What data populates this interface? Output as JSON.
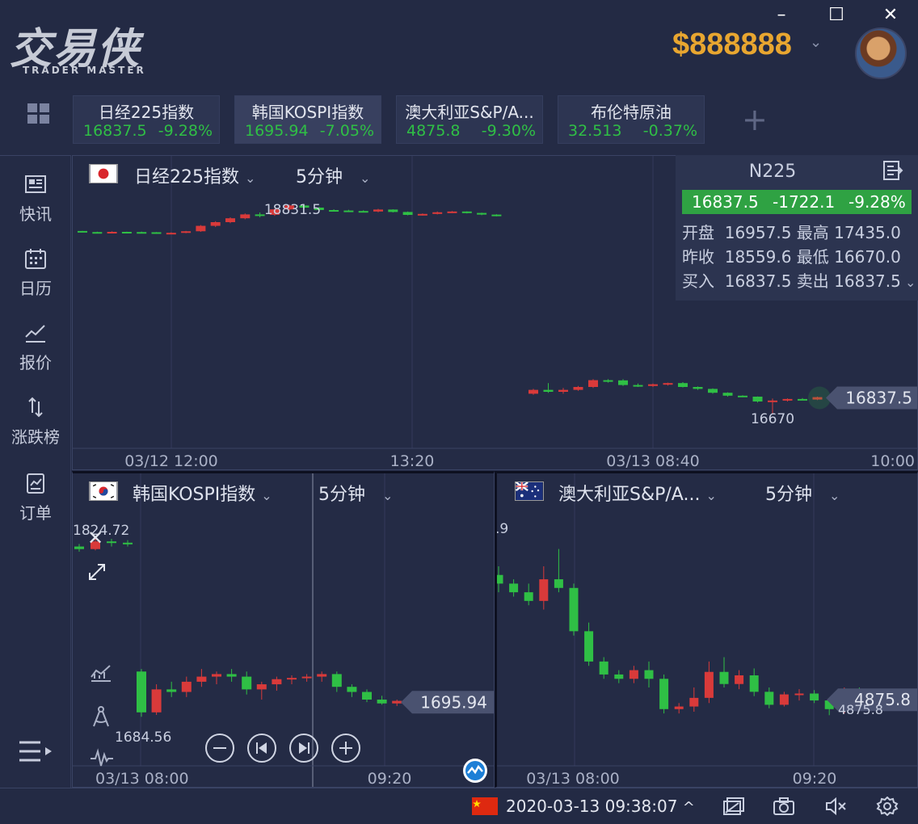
{
  "app": {
    "logo_text": "交易侠",
    "logo_sub": "TRADER MASTER",
    "balance": "$888888",
    "window": {
      "minimize": "–",
      "maximize": "☐",
      "close": "✕"
    }
  },
  "watchlist": [
    {
      "name": "日经225指数",
      "price": "16837.5",
      "change": "-9.28%"
    },
    {
      "name": "韩国KOSPI指数",
      "price": "1695.94",
      "change": "-7.05%"
    },
    {
      "name": "澳大利亚S&P/A...",
      "price": "4875.8",
      "change": "-9.30%"
    },
    {
      "name": "布伦特原油",
      "price": "32.513",
      "change": "-0.37%"
    }
  ],
  "add_tab_label": "+",
  "sidebar": [
    {
      "label": "快讯"
    },
    {
      "label": "日历"
    },
    {
      "label": "报价"
    },
    {
      "label": "涨跌榜"
    },
    {
      "label": "订单"
    }
  ],
  "main_chart": {
    "title": "日经225指数",
    "timeframe": "5分钟",
    "high_label": "18831.5",
    "low_label": "16670",
    "last_price_tag": "16837.5",
    "x_ticks": [
      "03/12 12:00",
      "13:20",
      "03/13 08:40",
      "10:00"
    ]
  },
  "info": {
    "symbol": "N225",
    "price": "16837.5",
    "change": "-1722.1",
    "change_pct": "-9.28%",
    "rows": [
      {
        "k1": "开盘",
        "v1": "16957.5",
        "k2": "最高",
        "v2": "17435.0"
      },
      {
        "k1": "昨收",
        "v1": "18559.6",
        "k2": "最低",
        "v2": "16670.0"
      },
      {
        "k1": "买入",
        "v1": "16837.5",
        "k2": "卖出",
        "v2": "16837.5"
      }
    ]
  },
  "kospi_chart": {
    "title": "韩国KOSPI指数",
    "timeframe": "5分钟",
    "high_label": "1824.72",
    "low_label": "1684.56",
    "last_price_tag": "1695.94",
    "x_ticks": [
      "03/13 08:00",
      "09:20"
    ]
  },
  "asx_chart": {
    "title": "澳大利亚S&P/A...",
    "timeframe": "5分钟",
    "edge_label": ".9",
    "last_price_tag": "4875.8",
    "low_label": "4875.8",
    "x_ticks": [
      "03/13 08:00",
      "09:20"
    ]
  },
  "statusbar": {
    "datetime": "2020-03-13 09:38:07"
  },
  "colors": {
    "up": "#d93a3a",
    "down": "#2fbf45",
    "accent": "#e8a630",
    "bg": "#242b45"
  },
  "chart_data": [
    {
      "type": "candlestick",
      "name": "日经225指数",
      "note_segments": "left session 03/12, right session 03/13",
      "candles": [
        [
          18559,
          18560,
          18545,
          18548
        ],
        [
          18548,
          18552,
          18538,
          18545
        ],
        [
          18548,
          18556,
          18542,
          18550
        ],
        [
          18550,
          18552,
          18544,
          18548
        ],
        [
          18548,
          18553,
          18540,
          18546
        ],
        [
          18546,
          18548,
          18530,
          18534
        ],
        [
          18534,
          18545,
          18530,
          18540
        ],
        [
          18540,
          18560,
          18536,
          18556
        ],
        [
          18556,
          18620,
          18550,
          18612
        ],
        [
          18612,
          18660,
          18600,
          18650
        ],
        [
          18650,
          18700,
          18640,
          18690
        ],
        [
          18690,
          18740,
          18680,
          18730
        ],
        [
          18730,
          18750,
          18700,
          18726
        ],
        [
          18726,
          18790,
          18715,
          18782
        ],
        [
          18782,
          18831,
          18770,
          18822
        ],
        [
          18822,
          18831,
          18790,
          18800
        ],
        [
          18800,
          18808,
          18770,
          18775
        ],
        [
          18775,
          18783,
          18760,
          18770
        ],
        [
          18770,
          18778,
          18760,
          18765
        ],
        [
          18765,
          18773,
          18750,
          18760
        ],
        [
          18760,
          18788,
          18752,
          18780
        ],
        [
          18780,
          18783,
          18750,
          18755
        ],
        [
          18755,
          18760,
          18720,
          18725
        ],
        [
          18725,
          18740,
          18718,
          18735
        ],
        [
          18735,
          18760,
          18730,
          18752
        ],
        [
          18752,
          18765,
          18745,
          18760
        ],
        [
          18760,
          18762,
          18740,
          18745
        ],
        [
          18745,
          18748,
          18722,
          18728
        ],
        [
          18728,
          18732,
          18710,
          18718
        ],
        [
          16880,
          16930,
          16870,
          16920
        ],
        [
          16920,
          16990,
          16890,
          16900
        ],
        [
          16900,
          16940,
          16880,
          16920
        ],
        [
          16920,
          16960,
          16910,
          16950
        ],
        [
          16950,
          17030,
          16940,
          17020
        ],
        [
          17020,
          17030,
          16995,
          17018
        ],
        [
          17018,
          17030,
          16960,
          16970
        ],
        [
          16970,
          16985,
          16950,
          16960
        ],
        [
          16960,
          16985,
          16950,
          16978
        ],
        [
          16978,
          16995,
          16965,
          16990
        ],
        [
          16990,
          17000,
          16945,
          16950
        ],
        [
          16950,
          16955,
          16920,
          16930
        ],
        [
          16930,
          16935,
          16880,
          16890
        ],
        [
          16890,
          16895,
          16850,
          16860
        ],
        [
          16860,
          16865,
          16845,
          16850
        ],
        [
          16850,
          16852,
          16790,
          16800
        ],
        [
          16800,
          16830,
          16670,
          16810
        ],
        [
          16810,
          16832,
          16800,
          16826
        ],
        [
          16826,
          16835,
          16815,
          16820
        ],
        [
          16820,
          16850,
          16815,
          16845
        ],
        [
          16845,
          16850,
          16830,
          16837.5
        ]
      ],
      "x_ticks": [
        "03/12 12:00",
        "13:20",
        "03/13 08:40",
        "10:00"
      ],
      "high": 18831.5,
      "low": 16670
    },
    {
      "type": "candlestick",
      "name": "韩国KOSPI指数",
      "candles": [
        [
          1818,
          1820,
          1814,
          1816
        ],
        [
          1816,
          1824.72,
          1815,
          1822
        ],
        [
          1822,
          1824,
          1818,
          1821
        ],
        [
          1821,
          1823,
          1818,
          1820
        ],
        [
          1720,
          1722,
          1684.56,
          1688
        ],
        [
          1688,
          1710,
          1686,
          1706
        ],
        [
          1706,
          1712,
          1700,
          1704
        ],
        [
          1704,
          1716,
          1700,
          1712
        ],
        [
          1712,
          1722,
          1708,
          1716
        ],
        [
          1716,
          1720,
          1710,
          1718
        ],
        [
          1718,
          1722,
          1712,
          1716
        ],
        [
          1716,
          1720,
          1702,
          1706
        ],
        [
          1706,
          1712,
          1698,
          1710
        ],
        [
          1710,
          1716,
          1705,
          1714
        ],
        [
          1714,
          1717,
          1710,
          1715
        ],
        [
          1715,
          1718,
          1712,
          1716
        ],
        [
          1716,
          1720,
          1712,
          1718
        ],
        [
          1718,
          1720,
          1704,
          1708
        ],
        [
          1708,
          1710,
          1700,
          1704
        ],
        [
          1704,
          1706,
          1696,
          1698
        ],
        [
          1698,
          1701,
          1694,
          1695
        ],
        [
          1695,
          1698,
          1693,
          1697
        ],
        [
          1697,
          1702,
          1693,
          1694
        ],
        [
          1694,
          1700,
          1693,
          1695.94
        ]
      ],
      "x_ticks": [
        "03/13 08:00",
        "09:20"
      ],
      "high": 1824.72,
      "low": 1684.56
    },
    {
      "type": "candlestick",
      "name": "澳大利亚S&P/A...",
      "candles": [
        [
          5020,
          5030,
          5000,
          5010
        ],
        [
          5010,
          5015,
          4995,
          5000
        ],
        [
          5000,
          5010,
          4985,
          4990
        ],
        [
          4990,
          5030,
          4980,
          5015
        ],
        [
          5015,
          5050,
          5000,
          5005
        ],
        [
          5005,
          5010,
          4950,
          4955
        ],
        [
          4955,
          4965,
          4915,
          4920
        ],
        [
          4920,
          4925,
          4900,
          4905
        ],
        [
          4905,
          4910,
          4895,
          4900
        ],
        [
          4900,
          4915,
          4895,
          4910
        ],
        [
          4910,
          4920,
          4890,
          4900
        ],
        [
          4900,
          4905,
          4860,
          4865
        ],
        [
          4865,
          4872,
          4860,
          4868
        ],
        [
          4868,
          4890,
          4862,
          4878
        ],
        [
          4878,
          4920,
          4872,
          4908
        ],
        [
          4908,
          4925,
          4890,
          4894
        ],
        [
          4894,
          4910,
          4888,
          4904
        ],
        [
          4904,
          4912,
          4880,
          4885
        ],
        [
          4885,
          4890,
          4866,
          4870
        ],
        [
          4870,
          4885,
          4868,
          4882
        ],
        [
          4882,
          4888,
          4875,
          4883
        ],
        [
          4883,
          4887,
          4872,
          4875
        ],
        [
          4875,
          4878,
          4858,
          4865
        ],
        [
          4865,
          4890,
          4860,
          4880
        ],
        [
          4880,
          4890,
          4868,
          4875.8
        ]
      ],
      "x_ticks": [
        "03/13 08:00",
        "09:20"
      ],
      "last": 4875.8
    }
  ]
}
